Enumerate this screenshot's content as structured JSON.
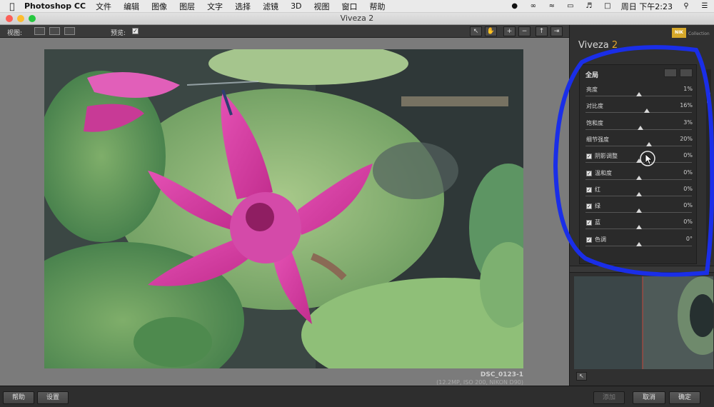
{
  "menubar": {
    "app_name": "Photoshop CC",
    "items": [
      "文件",
      "编辑",
      "图像",
      "图层",
      "文字",
      "选择",
      "滤镜",
      "3D",
      "视图",
      "窗口",
      "帮助"
    ],
    "clock": "周日 下午2:23"
  },
  "window": {
    "title": "Viveza 2"
  },
  "toolbar": {
    "view_label": "视图:",
    "preview_label": "预览:",
    "preview_checked": true
  },
  "file_info": {
    "name": "DSC_0123-1",
    "meta": "(12.2MP, ISO 200, NIKON D90)"
  },
  "panel": {
    "title_main": "Viveza",
    "title_accent": " 2",
    "section_label": "全局",
    "adjustments": [
      {
        "label": "亮度",
        "value": "1%",
        "checkbox": false,
        "position": 0.505
      },
      {
        "label": "对比度",
        "value": "16%",
        "checkbox": false,
        "position": 0.58
      },
      {
        "label": "饱和度",
        "value": "3%",
        "checkbox": false,
        "position": 0.515
      },
      {
        "label": "细节强度",
        "value": "20%",
        "checkbox": false,
        "position": 0.6
      },
      {
        "label": "阴影调整",
        "value": "0%",
        "checkbox": true,
        "position": 0.5
      },
      {
        "label": "温和度",
        "value": "0%",
        "checkbox": true,
        "position": 0.5
      },
      {
        "label": "红",
        "value": "0%",
        "checkbox": true,
        "position": 0.5
      },
      {
        "label": "绿",
        "value": "0%",
        "checkbox": true,
        "position": 0.5
      },
      {
        "label": "蓝",
        "value": "0%",
        "checkbox": true,
        "position": 0.5
      },
      {
        "label": "色调",
        "value": "0°",
        "checkbox": true,
        "position": 0.5
      }
    ]
  },
  "bottom": {
    "help": "帮助",
    "settings": "设置",
    "disabled": "添加",
    "cancel": "取消",
    "ok": "确定"
  },
  "colors": {
    "accent": "#e3a629",
    "annotation": "#1a2ee8"
  }
}
